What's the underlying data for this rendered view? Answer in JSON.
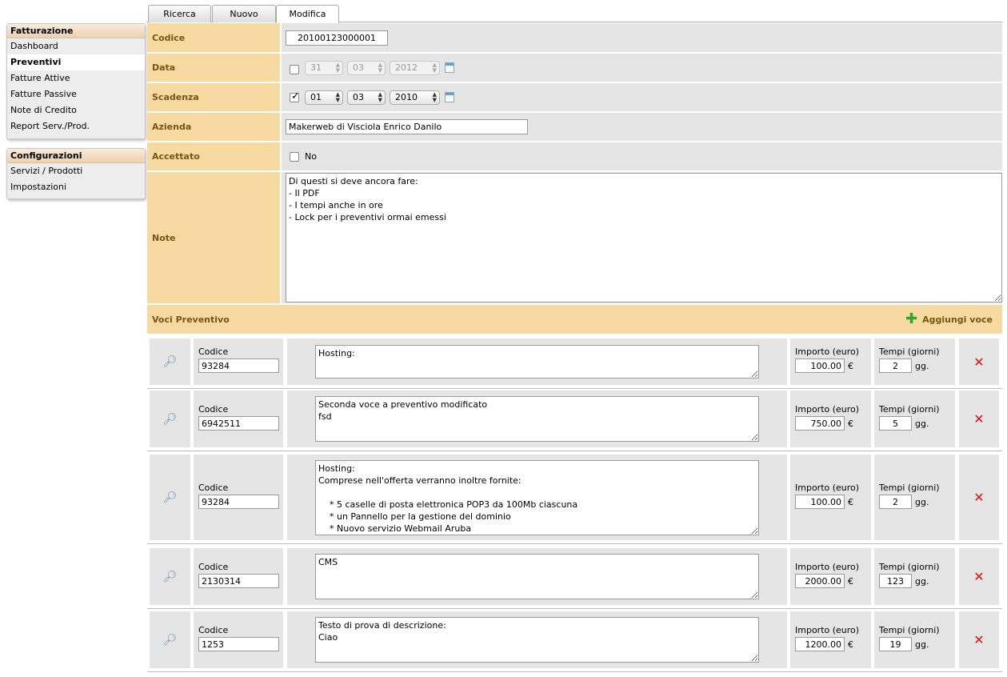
{
  "tabs": [
    {
      "label": "Ricerca"
    },
    {
      "label": "Nuovo"
    },
    {
      "label": "Modifica"
    }
  ],
  "sidebar": {
    "fatturazione": {
      "title": "Fatturazione",
      "items": [
        {
          "label": "Dashboard"
        },
        {
          "label": "Preventivi"
        },
        {
          "label": "Fatture Attive"
        },
        {
          "label": "Fatture Passive"
        },
        {
          "label": "Note di Credito"
        },
        {
          "label": "Report Serv./Prod."
        }
      ]
    },
    "configurazioni": {
      "title": "Configurazioni",
      "items": [
        {
          "label": "Servizi / Prodotti"
        },
        {
          "label": "Impostazioni"
        }
      ]
    }
  },
  "form": {
    "codice": {
      "label": "Codice",
      "value": "20100123000001"
    },
    "data": {
      "label": "Data",
      "day": "31",
      "month": "03",
      "year": "2012"
    },
    "scadenza": {
      "label": "Scadenza",
      "day": "01",
      "month": "03",
      "year": "2010"
    },
    "azienda": {
      "label": "Azienda",
      "value": "Makerweb di Visciola Enrico Danilo"
    },
    "accettato": {
      "label": "Accettato",
      "option": "No"
    },
    "note": {
      "label": "Note",
      "value": "Di questi si deve ancora fare:\n- Il PDF\n- I tempi anche in ore\n- Lock per i preventivi ormai emessi"
    }
  },
  "voci": {
    "title": "Voci Preventivo",
    "add_label": "Aggiungi voce",
    "col_codice": "Codice",
    "col_importo": "Importo (euro)",
    "col_tempi": "Tempi (giorni)",
    "currency": "€",
    "unit": "gg.",
    "items": [
      {
        "codice": "93284",
        "descrizione": "Hosting:",
        "importo": "100.00",
        "tempi": "2"
      },
      {
        "codice": "6942511",
        "descrizione": "Seconda voce a preventivo modificato\nfsd",
        "importo": "750.00",
        "tempi": "5"
      },
      {
        "codice": "93284",
        "descrizione": "Hosting:\nComprese nell'offerta verranno inoltre fornite:\n\n    * 5 caselle di posta elettronica POP3 da 100Mb ciascuna\n    * un Pannello per la gestione del dominio\n    * Nuovo servizio Webmail Aruba",
        "importo": "100.00",
        "tempi": "2"
      },
      {
        "codice": "2130314",
        "descrizione": "CMS",
        "importo": "2000.00",
        "tempi": "123"
      },
      {
        "codice": "1253",
        "descrizione": "Testo di prova di descrizione:\nCiao",
        "importo": "1200.00",
        "tempi": "19"
      }
    ]
  }
}
